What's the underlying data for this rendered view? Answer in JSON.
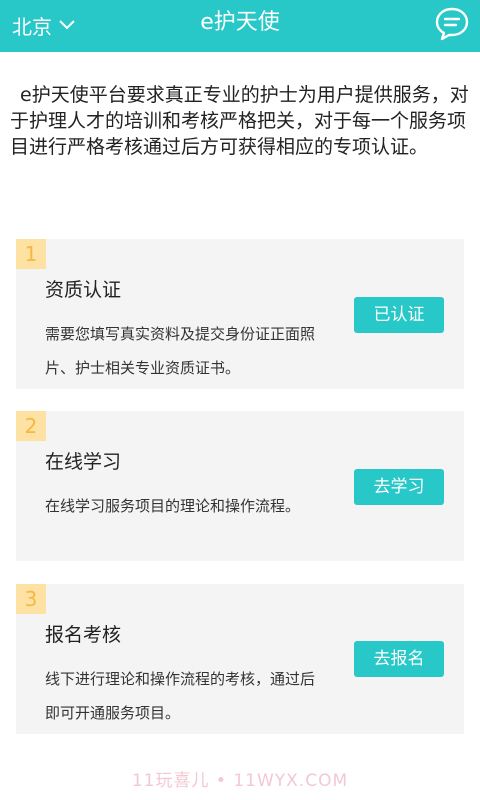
{
  "header": {
    "city": "北京",
    "title": "e护天使"
  },
  "intro": "e护天使平台要求真正专业的护士为用户提供服务，对于护理人才的培训和考核严格把关，对于每一个服务项目进行严格考核通过后方可获得相应的专项认证。",
  "steps": [
    {
      "number": "1",
      "title": "资质认证",
      "desc": "需要您填写真实资料及提交身份证正面照片、护士相关专业资质证书。",
      "button": "已认证"
    },
    {
      "number": "2",
      "title": "在线学习",
      "desc": "在线学习服务项目的理论和操作流程。",
      "button": "去学习"
    },
    {
      "number": "3",
      "title": "报名考核",
      "desc": "线下进行理论和操作流程的考核，通过后即可开通服务项目。",
      "button": "去报名"
    }
  ],
  "watermark": "11玩喜儿 • 11WYX.COM",
  "colors": {
    "accent": "#28c8c8",
    "card_bg": "#f4f4f4",
    "badge_bg": "#fde2a4",
    "badge_text": "#f5b942"
  },
  "icons": {
    "city_dropdown": "chevron-down-icon",
    "messages": "chat-bubble-icon"
  }
}
